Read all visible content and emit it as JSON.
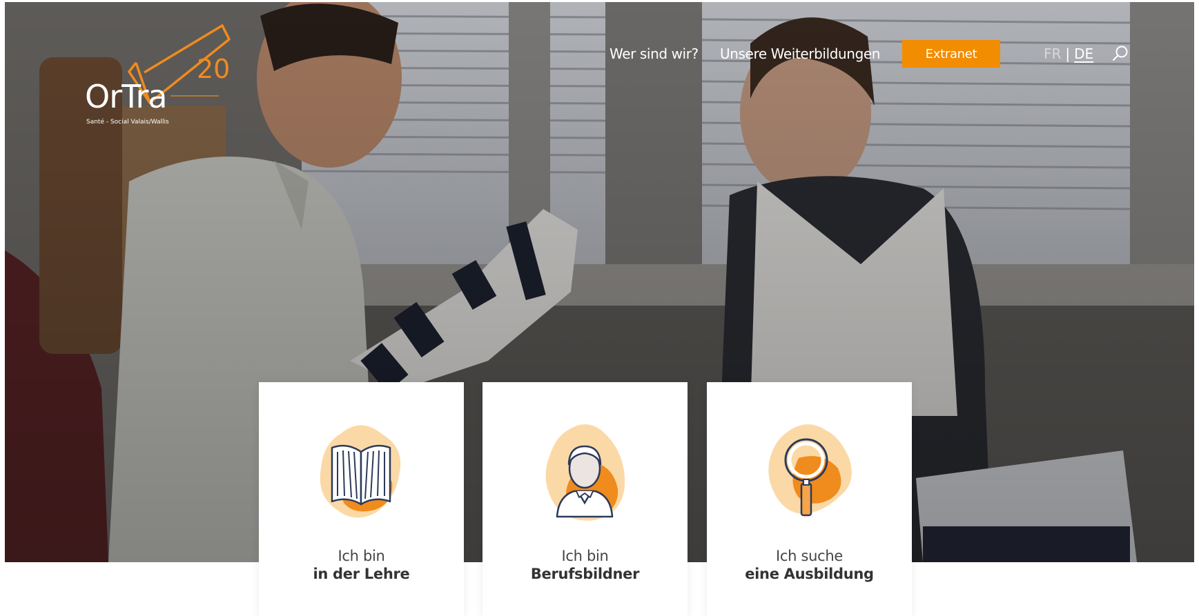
{
  "logo": {
    "word": "OrTra",
    "number": "20",
    "tagline": "Santé - Social Valais/Wallis"
  },
  "nav": {
    "links": [
      "Wer sind wir?",
      "Unsere Weiterbildungen"
    ],
    "extranet_label": "Extranet",
    "lang_fr": "FR",
    "lang_separator": "|",
    "lang_de": "DE",
    "active_language": "DE"
  },
  "cards": [
    {
      "line1": "Ich bin",
      "line2": "in der Lehre",
      "icon": "open-book-icon"
    },
    {
      "line1": "Ich bin",
      "line2": "Berufsbildner",
      "icon": "person-icon"
    },
    {
      "line1": "Ich suche",
      "line2": "eine Ausbildung",
      "icon": "magnifier-icon"
    }
  ],
  "colors": {
    "accent": "#f28c00",
    "icon_blob_light": "#fbd9a6",
    "icon_blob_dark": "#f08b1d",
    "icon_stroke": "#2c3a5a"
  }
}
